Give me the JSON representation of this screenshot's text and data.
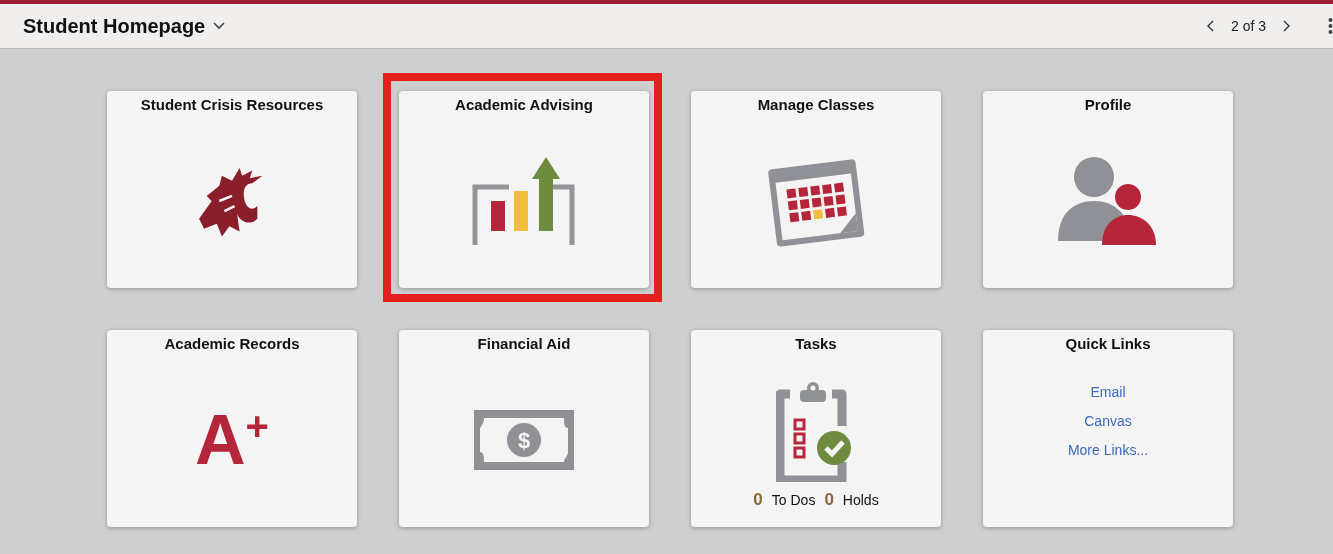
{
  "header": {
    "title": "Student Homepage",
    "pager": "2 of 3"
  },
  "tiles": [
    {
      "title": "Student Crisis Resources",
      "kind": "icon",
      "highlighted": false
    },
    {
      "title": "Academic Advising",
      "kind": "icon",
      "highlighted": true
    },
    {
      "title": "Manage Classes",
      "kind": "icon",
      "highlighted": false
    },
    {
      "title": "Profile",
      "kind": "icon",
      "highlighted": false
    },
    {
      "title": "Academic Records",
      "kind": "grade",
      "grade": "A$^{+}$",
      "highlighted": false
    },
    {
      "title": "Financial Aid",
      "kind": "icon",
      "symbol": "$",
      "highlighted": false
    },
    {
      "title": "Tasks",
      "kind": "counts",
      "counts": [
        {
          "kind": "number",
          "text": "0"
        },
        {
          "kind": "caption",
          "text": "To Dos"
        },
        {
          "kind": "number",
          "text": "0"
        },
        {
          "kind": "caption",
          "text": "Holds"
        }
      ],
      "highlighted": false
    },
    {
      "title": "Quick Links",
      "kind": "links",
      "links": [
        "Email",
        "Canvas",
        "More Links..."
      ],
      "highlighted": false
    }
  ]
}
